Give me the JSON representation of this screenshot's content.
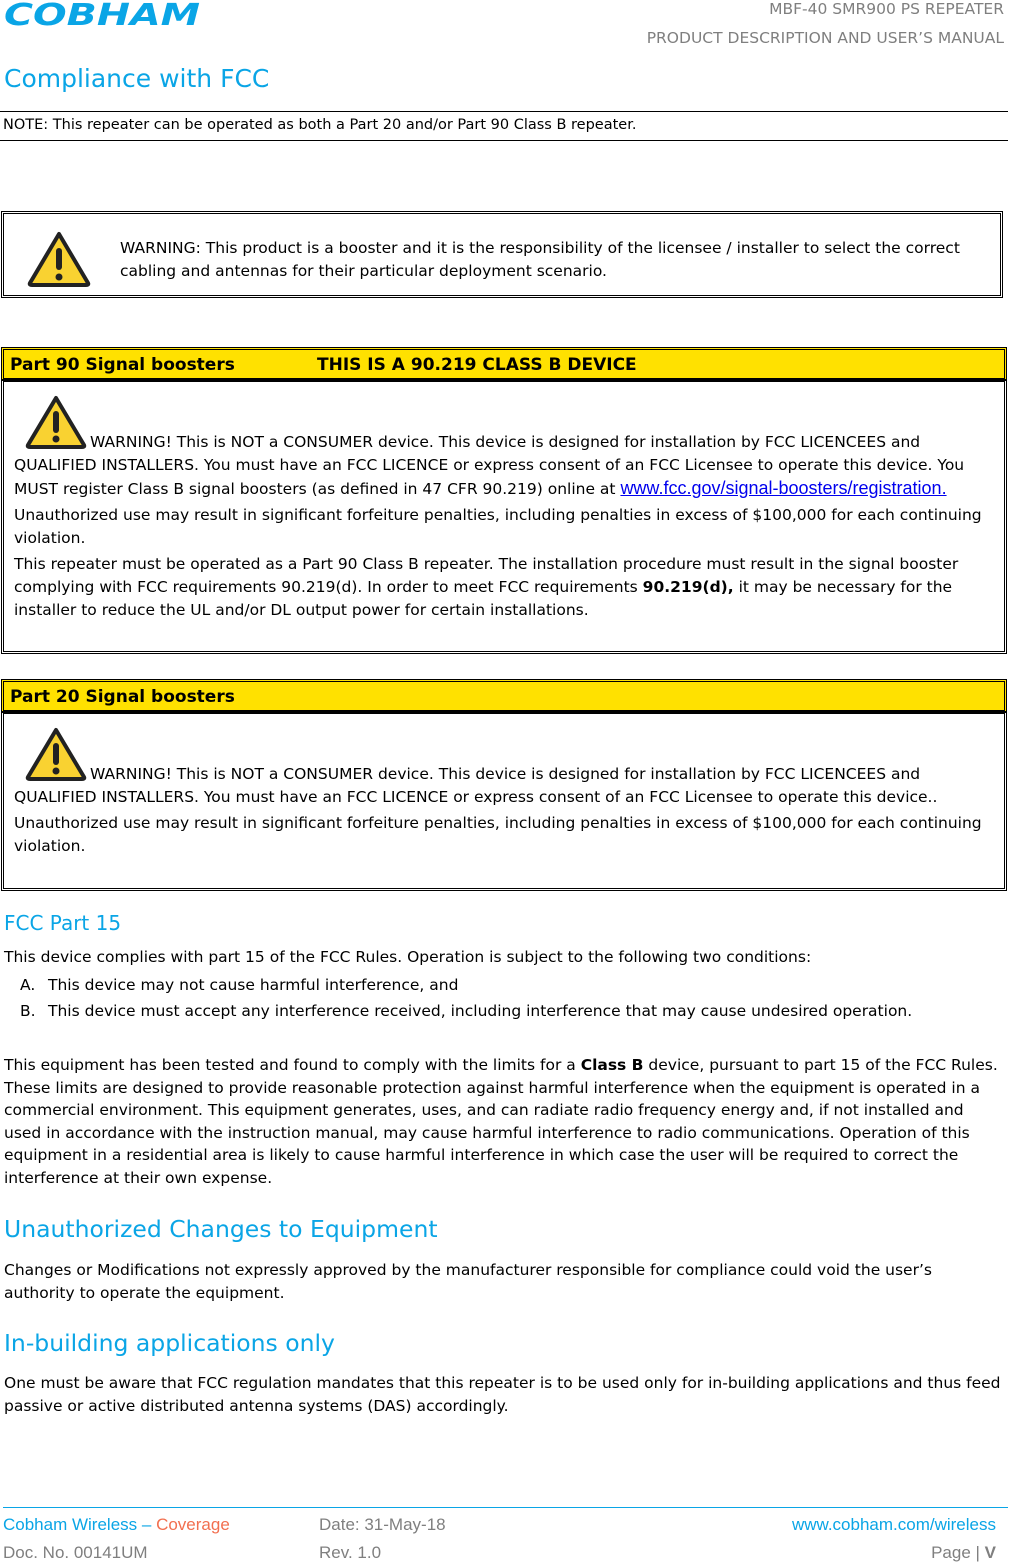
{
  "header": {
    "logo_text": "COBHAM",
    "doc_title_line1": "MBF-40 SMR900 PS REPEATER",
    "doc_title_line2": "PRODUCT DESCRIPTION AND USER’S MANUAL"
  },
  "page_title": "Compliance with FCC",
  "note": "NOTE: This repeater can be operated as both a Part 20 and/or Part 90 Class B repeater.",
  "warning_box": {
    "icon": "warning-triangle-icon",
    "text": "WARNING: This product is a booster and it is the responsibility of the licensee / installer to select the correct cabling and antennas for their particular deployment scenario."
  },
  "part90": {
    "heading_left": "Part 90 Signal boosters",
    "heading_right": "THIS IS A 90.219 CLASS B DEVICE",
    "icon": "warning-triangle-icon",
    "warning_text": "WARNING! This is NOT a CONSUMER device. This device is designed for installation by FCC LICENCEES and QUALIFIED INSTALLERS. You must have an FCC LICENCE or express consent of an FCC Licensee to operate this device. You MUST register Class B signal boosters (as defined in 47 CFR 90.219) online at ",
    "link_text": "www.fcc.gov/signal-boosters/registration.",
    "penalty_text": "Unauthorized use may result in significant forfeiture penalties, including penalties in excess of $100,000 for each continuing violation.",
    "operation_text_1": "This repeater must be operated as a Part 90 Class B repeater. The installation procedure must result in the signal booster complying with FCC requirements 90.219(d). In order to meet FCC requirements ",
    "operation_text_bold": "90.219(d),",
    "operation_text_2": " it may be necessary for the installer to reduce the UL and/or DL output power for certain installations."
  },
  "part20": {
    "heading": "Part 20 Signal boosters",
    "icon": "warning-triangle-icon",
    "warning_text": "WARNING! This is NOT a CONSUMER device. This device is designed for installation by FCC LICENCEES and QUALIFIED INSTALLERS. You must have an FCC LICENCE or express consent of an FCC Licensee to operate this device..",
    "penalty_text": "Unauthorized use may result in significant forfeiture penalties, including penalties in excess of $100,000 for each continuing violation."
  },
  "fcc_part15": {
    "heading": "FCC Part 15",
    "intro": "This device complies with part 15 of the FCC Rules. Operation is subject to the following two conditions:",
    "conditions": [
      {
        "marker": "A.",
        "text": "This device may not cause harmful interference, and"
      },
      {
        "marker": "B.",
        "text": "This device must accept any interference received, including interference that may cause undesired operation."
      }
    ],
    "para_1": "This equipment has been tested and found to comply with the limits for a ",
    "para_bold": "Class B",
    "para_2": " device, pursuant to part 15 of the FCC Rules. These limits are designed to provide reasonable protection against harmful interference when the equipment is operated in a commercial environment. This equipment generates, uses, and can radiate radio frequency energy and, if not installed and used in accordance with the instruction manual, may cause harmful interference to radio communications. Operation of this equipment in a residential area is likely to cause harmful interference in which case the user will be required to correct the interference at their own expense."
  },
  "unauthorized_changes": {
    "heading": "Unauthorized Changes to Equipment",
    "text": "Changes or Modifications not expressly approved by the manufacturer responsible for compliance could void the user’s authority to operate the equipment."
  },
  "in_building": {
    "heading": "In-building applications only",
    "text": "One must be aware that FCC regulation mandates that this repeater is to be used only for in-building applications and thus feed passive or active distributed antenna systems (DAS) accordingly."
  },
  "footer": {
    "company": "Cobham Wireless",
    "dash": " – ",
    "division": "Coverage",
    "date": "Date: 31-May-18",
    "website": "www.cobham.com/wireless",
    "doc_no": "Doc. No. 00141UM",
    "rev": "Rev. 1.0",
    "page_label": "Page | ",
    "page_number": "V"
  },
  "colors": {
    "heading_blue": "#0aa5e6",
    "box_yellow": "#ffe100",
    "footer_orange": "#f26f4f",
    "footer_grey": "#7f7f7f",
    "link_blue": "#0000ee",
    "warning_yellow": "#f9d231"
  }
}
